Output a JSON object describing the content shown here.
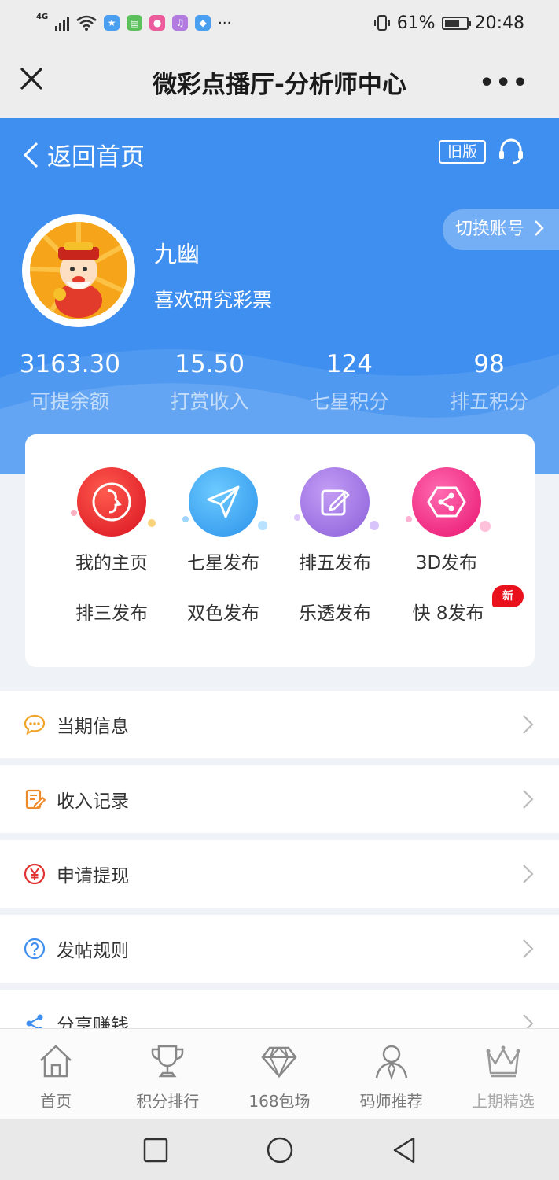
{
  "status_bar": {
    "network": "4G",
    "battery_percent": "61%",
    "time": "20:48",
    "overflow": "···",
    "colors": {
      "blue": "#4a9ff0",
      "green": "#5cc15c",
      "pink": "#ec5b9c",
      "purple": "#b27be0"
    }
  },
  "title_bar": {
    "title": "微彩点播厅-分析师中心",
    "more": "•••",
    "close_icon": "close-icon"
  },
  "header": {
    "back_label": "返回首页",
    "old_version": "旧版",
    "switch_account": "切换账号",
    "user": {
      "name": "九幽",
      "signature": "喜欢研究彩票"
    },
    "stats": [
      {
        "value": "3163.30",
        "label": "可提余额"
      },
      {
        "value": "15.50",
        "label": "打赏收入"
      },
      {
        "value": "124",
        "label": "七星积分"
      },
      {
        "value": "98",
        "label": "排五积分"
      }
    ],
    "accent": "#3f8ff0"
  },
  "grid": {
    "icon_items": [
      {
        "label": "我的主页",
        "icon": "face-icon",
        "color": "#e8242c"
      },
      {
        "label": "七星发布",
        "icon": "paper-plane-icon",
        "color": "#3ca8f0"
      },
      {
        "label": "排五发布",
        "icon": "edit-icon",
        "color": "#9b6de0"
      },
      {
        "label": "3D发布",
        "icon": "share-hexagon-icon",
        "color": "#f02e86"
      }
    ],
    "text_items": [
      "排三发布",
      "双色发布",
      "乐透发布",
      "快 8发布"
    ],
    "new_badge": "新"
  },
  "menu": [
    {
      "label": "当期信息",
      "icon": "chat-bubble-icon"
    },
    {
      "label": "收入记录",
      "icon": "note-edit-icon"
    },
    {
      "label": "申请提现",
      "icon": "yuan-icon"
    },
    {
      "label": "发帖规则",
      "icon": "question-icon"
    },
    {
      "label": "分享赚钱",
      "icon": "share-icon"
    }
  ],
  "tabs": [
    {
      "label": "首页",
      "icon": "home-icon"
    },
    {
      "label": "积分排行",
      "icon": "trophy-icon"
    },
    {
      "label": "168包场",
      "icon": "diamond-icon"
    },
    {
      "label": "码师推荐",
      "icon": "person-icon"
    },
    {
      "label": "上期精选",
      "icon": "crown-icon"
    }
  ]
}
